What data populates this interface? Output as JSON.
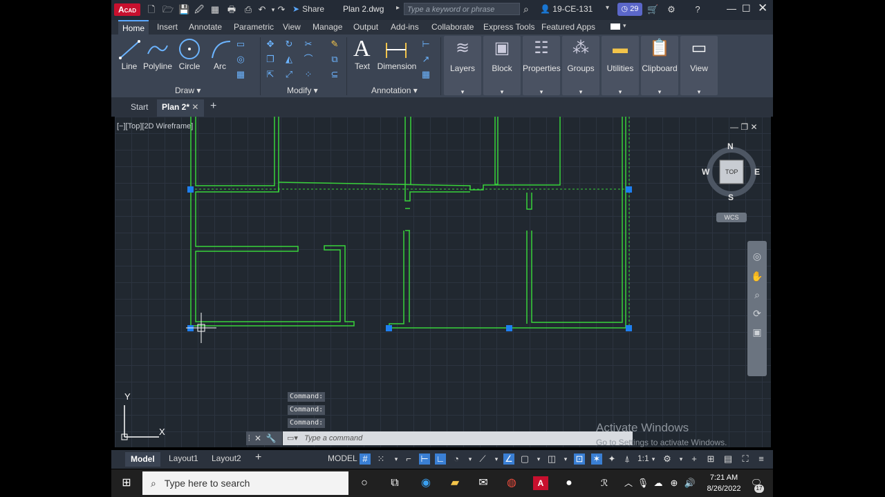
{
  "app": {
    "logo_main": "A",
    "logo_sub": "CAD",
    "share_label": "Share",
    "doc_title": "Plan 2.dwg",
    "search_placeholder": "Type a keyword or phrase",
    "user_name": "19-CE-131",
    "notif_count": "29"
  },
  "ribbon_tabs": [
    "Home",
    "Insert",
    "Annotate",
    "Parametric",
    "View",
    "Manage",
    "Output",
    "Add-ins",
    "Collaborate",
    "Express Tools",
    "Featured Apps"
  ],
  "draw_tools": [
    "Line",
    "Polyline",
    "Circle",
    "Arc"
  ],
  "panels": {
    "draw": "Draw",
    "modify": "Modify",
    "annotation": "Annotation"
  },
  "annotation_tools": [
    "Text",
    "Dimension"
  ],
  "big_tools": [
    "Layers",
    "Block",
    "Properties",
    "Groups",
    "Utilities",
    "Clipboard",
    "View"
  ],
  "file_tabs": {
    "start": "Start",
    "plan": "Plan 2*"
  },
  "viewport_label": "[−][Top][2D Wireframe]",
  "viewcube": {
    "n": "N",
    "s": "S",
    "e": "E",
    "w": "W",
    "top": "TOP",
    "wcs": "WCS"
  },
  "ucs": {
    "x": "X",
    "y": "Y"
  },
  "command_history": [
    "Command:",
    "Command:",
    "Command:"
  ],
  "command_placeholder": "Type a command",
  "watermark": {
    "line1": "Activate Windows",
    "line2": "Go to Settings to activate Windows."
  },
  "layout_tabs": [
    "Model",
    "Layout1",
    "Layout2"
  ],
  "status": {
    "model": "MODEL",
    "scale": "1:1"
  },
  "taskbar": {
    "search": "Type here to search",
    "time": "7:21 AM",
    "date": "8/26/2022",
    "notif": "17"
  },
  "colors": {
    "accent": "#5aa8ff",
    "lines": "#39d43a",
    "grip": "#1e7ff0"
  }
}
